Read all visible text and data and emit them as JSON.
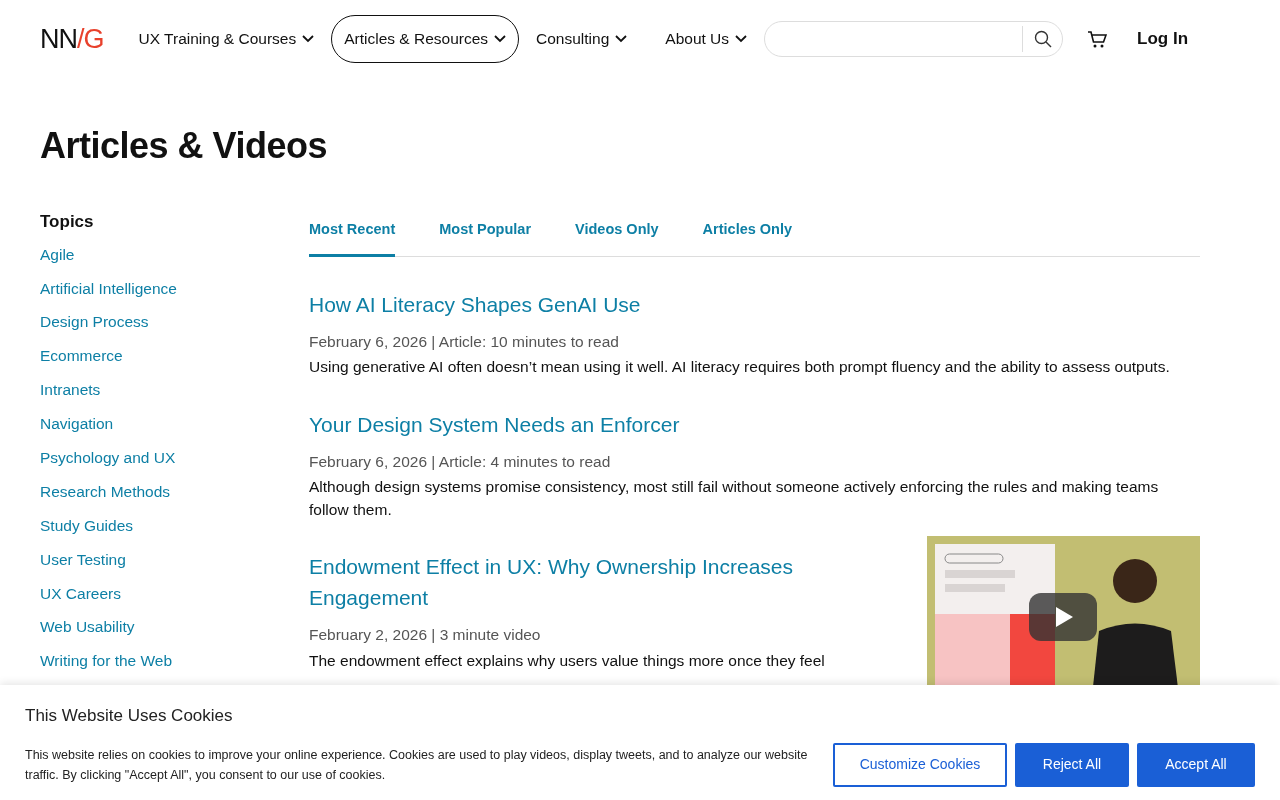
{
  "header": {
    "logo": {
      "left": "NN",
      "slash": "/",
      "right": "G"
    },
    "nav": [
      {
        "label": "UX Training & Courses",
        "selected": false
      },
      {
        "label": "Articles & Resources",
        "selected": true
      },
      {
        "label": "Consulting",
        "selected": false
      },
      {
        "label": "About Us",
        "selected": false
      }
    ],
    "login": "Log In"
  },
  "page_title": "Articles & Videos",
  "sidebar": {
    "heading": "Topics",
    "items": [
      "Agile",
      "Artificial Intelligence",
      "Design Process",
      "Ecommerce",
      "Intranets",
      "Navigation",
      "Psychology and UX",
      "Research Methods",
      "Study Guides",
      "User Testing",
      "UX Careers",
      "Web Usability",
      "Writing for the Web"
    ]
  },
  "tabs": [
    {
      "label": "Most Recent",
      "selected": true
    },
    {
      "label": "Most Popular",
      "selected": false
    },
    {
      "label": "Videos Only",
      "selected": false
    },
    {
      "label": "Articles Only",
      "selected": false
    }
  ],
  "articles": [
    {
      "title": "How AI Literacy Shapes GenAI Use",
      "meta": "February 6, 2026 | Article: 10 minutes to read",
      "summary": "Using generative AI often doesn’t mean using it well. AI literacy requires both prompt fluency and the ability to assess outputs."
    },
    {
      "title": "Your Design System Needs an Enforcer",
      "meta": "February 6, 2026 | Article: 4 minutes to read",
      "summary": "Although design systems promise consistency, most still fail without someone actively enforcing the rules and making teams follow them."
    },
    {
      "title": "Endowment Effect in UX: Why Ownership Increases Engagement",
      "meta": "February 2, 2026 | 3 minute video",
      "summary": "The endowment effect explains why users value things more once they feel"
    }
  ],
  "cookie_banner": {
    "title": "This Website Uses Cookies",
    "text": "This website relies on cookies to improve your online experience. Cookies are used to play videos, display tweets, and to analyze our website traffic. By clicking \"Accept All\", you consent to our use of cookies.",
    "buttons": [
      {
        "label": "Customize Cookies",
        "kind": "outline"
      },
      {
        "label": "Reject All",
        "kind": "solid"
      },
      {
        "label": "Accept All",
        "kind": "solid"
      }
    ]
  }
}
